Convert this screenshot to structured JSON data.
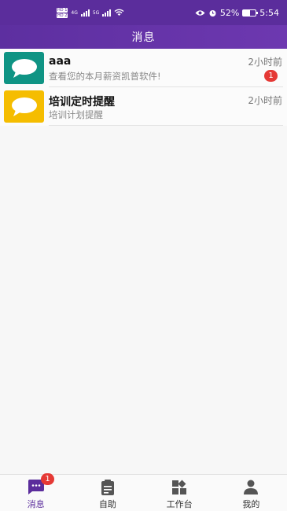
{
  "status_bar": {
    "sim1": "HD 1",
    "sim2": "HD 2",
    "net1": "4G",
    "net2": "5G",
    "battery_percent": "52%",
    "battery_level": 0.52,
    "time": "5:54"
  },
  "header": {
    "title": "消息"
  },
  "messages": [
    {
      "title": "aaa",
      "subtitle": "查看您的本月薪资凯普软件!",
      "time": "2小时前",
      "badge": "1",
      "avatar_color": "#0f9484",
      "icon": "chat-bubble-icon"
    },
    {
      "title": "培训定时提醒",
      "subtitle": "培训计划提醒",
      "time": "2小时前",
      "badge": "",
      "avatar_color": "#f5bd00",
      "icon": "chat-bubble-icon"
    }
  ],
  "tabbar": {
    "items": [
      {
        "label": "消息",
        "icon": "message-icon",
        "badge": "1",
        "active": true
      },
      {
        "label": "自助",
        "icon": "clipboard-icon",
        "active": false
      },
      {
        "label": "工作台",
        "icon": "dashboard-icon",
        "active": false
      },
      {
        "label": "我的",
        "icon": "person-icon",
        "active": false
      }
    ]
  },
  "colors": {
    "primary": "#5b2d9c",
    "badge": "#e53935"
  }
}
